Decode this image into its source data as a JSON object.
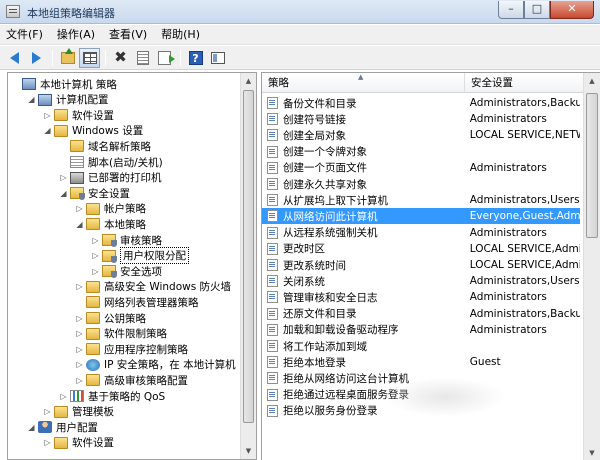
{
  "window": {
    "title": "本地组策略编辑器",
    "min_glyph": "–",
    "max_glyph": "□",
    "close_glyph": "✕"
  },
  "menu": [
    "文件(F)",
    "操作(A)",
    "查看(V)",
    "帮助(H)"
  ],
  "toolbar": {
    "icons": [
      "back-icon",
      "forward-icon",
      "up-folder-icon",
      "show-tree-icon",
      "delete-icon",
      "properties-icon",
      "export-icon",
      "help-icon",
      "panel-icon"
    ]
  },
  "tree": [
    {
      "label": "本地计算机 策略",
      "level": 0,
      "icon": "computer",
      "expander": ""
    },
    {
      "label": "计算机配置",
      "level": 1,
      "icon": "computer",
      "expander": "◢"
    },
    {
      "label": "软件设置",
      "level": 2,
      "icon": "folder",
      "expander": "▷"
    },
    {
      "label": "Windows 设置",
      "level": 2,
      "icon": "folder",
      "expander": "◢"
    },
    {
      "label": "域名解析策略",
      "level": 3,
      "icon": "folder",
      "expander": ""
    },
    {
      "label": "脚本(启动/关机)",
      "level": 3,
      "icon": "doc",
      "expander": ""
    },
    {
      "label": "已部署的打印机",
      "level": 3,
      "icon": "printer",
      "expander": "▷"
    },
    {
      "label": "安全设置",
      "level": 3,
      "icon": "shield",
      "expander": "◢"
    },
    {
      "label": "帐户策略",
      "level": 4,
      "icon": "folder",
      "expander": "▷"
    },
    {
      "label": "本地策略",
      "level": 4,
      "icon": "folder",
      "expander": "◢"
    },
    {
      "label": "审核策略",
      "level": 5,
      "icon": "shield",
      "expander": "▷"
    },
    {
      "label": "用户权限分配",
      "level": 5,
      "icon": "shield",
      "expander": "▷",
      "selected": true
    },
    {
      "label": "安全选项",
      "level": 5,
      "icon": "shield",
      "expander": "▷"
    },
    {
      "label": "高级安全 Windows 防火墙",
      "level": 4,
      "icon": "folder",
      "expander": "▷"
    },
    {
      "label": "网络列表管理器策略",
      "level": 4,
      "icon": "folder",
      "expander": ""
    },
    {
      "label": "公钥策略",
      "level": 4,
      "icon": "folder",
      "expander": "▷"
    },
    {
      "label": "软件限制策略",
      "level": 4,
      "icon": "folder",
      "expander": "▷"
    },
    {
      "label": "应用程序控制策略",
      "level": 4,
      "icon": "folder",
      "expander": "▷"
    },
    {
      "label": "IP 安全策略，在 本地计算机",
      "level": 4,
      "icon": "globe",
      "expander": "▷"
    },
    {
      "label": "高级审核策略配置",
      "level": 4,
      "icon": "folder",
      "expander": "▷"
    },
    {
      "label": "基于策略的 QoS",
      "level": 3,
      "icon": "chart",
      "expander": "▷"
    },
    {
      "label": "管理模板",
      "level": 2,
      "icon": "folder",
      "expander": "▷"
    },
    {
      "label": "用户配置",
      "level": 1,
      "icon": "user",
      "expander": "◢"
    },
    {
      "label": "软件设置",
      "level": 2,
      "icon": "folder",
      "expander": "▷"
    }
  ],
  "columns": {
    "policy": "策略",
    "setting": "安全设置",
    "sort_glyph": "▲"
  },
  "policies": [
    {
      "name": "备份文件和目录",
      "value": "Administrators,Backup ..."
    },
    {
      "name": "创建符号链接",
      "value": "Administrators"
    },
    {
      "name": "创建全局对象",
      "value": "LOCAL SERVICE,NETWO..."
    },
    {
      "name": "创建一个令牌对象",
      "value": ""
    },
    {
      "name": "创建一个页面文件",
      "value": "Administrators"
    },
    {
      "name": "创建永久共享对象",
      "value": ""
    },
    {
      "name": "从扩展坞上取下计算机",
      "value": "Administrators,Users"
    },
    {
      "name": "从网络访问此计算机",
      "value": "Everyone,Guest,Adminis...",
      "selected": true
    },
    {
      "name": "从远程系统强制关机",
      "value": "Administrators"
    },
    {
      "name": "更改时区",
      "value": "LOCAL SERVICE,Admini..."
    },
    {
      "name": "更改系统时间",
      "value": "LOCAL SERVICE,Admini..."
    },
    {
      "name": "关闭系统",
      "value": "Administrators,Users,Ba..."
    },
    {
      "name": "管理审核和安全日志",
      "value": "Administrators"
    },
    {
      "name": "还原文件和目录",
      "value": "Administrators,Backup ..."
    },
    {
      "name": "加载和卸载设备驱动程序",
      "value": "Administrators"
    },
    {
      "name": "将工作站添加到域",
      "value": ""
    },
    {
      "name": "拒绝本地登录",
      "value": "Guest"
    },
    {
      "name": "拒绝从网络访问这台计算机",
      "value": ""
    },
    {
      "name": "拒绝通过远程桌面服务登录",
      "value": ""
    },
    {
      "name": "拒绝以服务身份登录",
      "value": ""
    }
  ],
  "scroll_glyphs": {
    "up": "▲",
    "down": "▼"
  }
}
